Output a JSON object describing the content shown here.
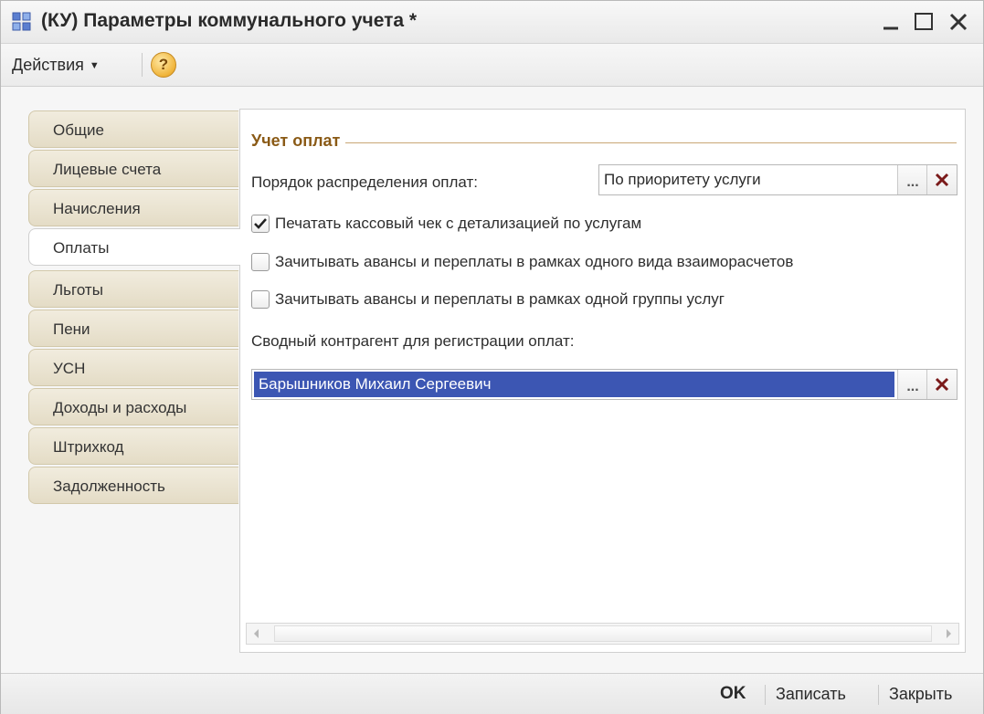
{
  "window": {
    "title": "(КУ) Параметры коммунального учета *"
  },
  "toolbar": {
    "actions_label": "Действия",
    "help_label": "?"
  },
  "tabs": [
    {
      "label": "Общие",
      "active": false
    },
    {
      "label": "Лицевые счета",
      "active": false
    },
    {
      "label": "Начисления",
      "active": false
    },
    {
      "label": "Оплаты",
      "active": true
    },
    {
      "label": "Льготы",
      "active": false
    },
    {
      "label": "Пени",
      "active": false
    },
    {
      "label": "УСН",
      "active": false
    },
    {
      "label": "Доходы и расходы",
      "active": false
    },
    {
      "label": "Штрихкод",
      "active": false
    },
    {
      "label": "Задолженность",
      "active": false
    }
  ],
  "payments": {
    "group_title": "Учет оплат",
    "distribution_order_label": "Порядок распределения оплат:",
    "distribution_order_value": "По приоритету услуги",
    "options": [
      {
        "label": "Печатать кассовый чек с детализацией по услугам",
        "checked": true
      },
      {
        "label": "Зачитывать авансы и переплаты в рамках одного вида взаиморасчетов",
        "checked": false
      },
      {
        "label": "Зачитывать авансы и переплаты в рамках одной группы услуг",
        "checked": false
      }
    ],
    "counterparty_label": "Сводный контрагент для регистрации оплат:",
    "counterparty_value": "Барышников Михаил Сергеевич",
    "select_button": "...",
    "clear_button": "×"
  },
  "footer": {
    "ok_label": "OK",
    "save_label": "Записать",
    "close_label": "Закрыть"
  },
  "colors": {
    "accent_title": "#8a5a16",
    "selection": "#3c56b3",
    "tab_bg": "#e4dcc6",
    "clear_x": "#7a1a1a"
  },
  "icons": {
    "title": "form-icon",
    "help": "help-icon",
    "clear": "clear-x-icon"
  }
}
